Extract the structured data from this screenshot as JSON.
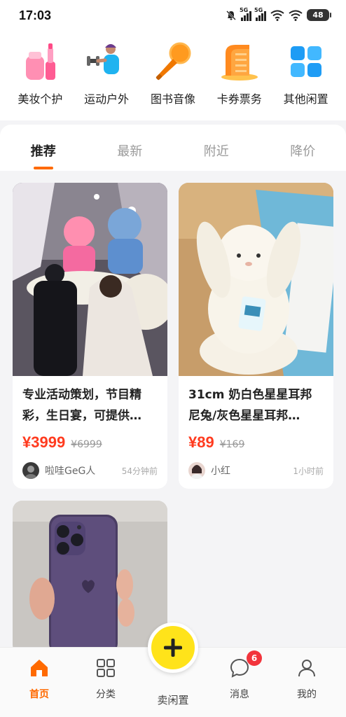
{
  "status_bar": {
    "time": "17:03",
    "network_1": "5G",
    "network_2": "5G",
    "battery": "48"
  },
  "categories": [
    {
      "label": "美妆个护",
      "icon": "cosmetics-icon"
    },
    {
      "label": "运动户外",
      "icon": "fitness-icon"
    },
    {
      "label": "图书音像",
      "icon": "microphone-icon"
    },
    {
      "label": "卡券票务",
      "icon": "ticket-building-icon"
    },
    {
      "label": "其他闲置",
      "icon": "grid-icon"
    }
  ],
  "tabs": [
    {
      "label": "推荐",
      "active": true
    },
    {
      "label": "最新",
      "active": false
    },
    {
      "label": "附近",
      "active": false
    },
    {
      "label": "降价",
      "active": false
    }
  ],
  "feed": [
    {
      "title": "专业活动策划，节目精彩，生日宴，可提供…",
      "price": "¥3999",
      "original_price": "¥6999",
      "seller": "啦哇GeG人",
      "time": "54分钟前",
      "image": "lion-dance-wedding-photo"
    },
    {
      "title": "31cm 奶白色星星耳邦尼兔/灰色星星耳邦…",
      "price": "¥89",
      "original_price": "¥169",
      "seller": "小红",
      "time": "1小时前",
      "image": "plush-bunny-photo"
    },
    {
      "title": "",
      "image": "purple-iphone-photo"
    }
  ],
  "bottom_nav": {
    "home": "首页",
    "category": "分类",
    "sell": "卖闲置",
    "messages": "消息",
    "messages_badge": "6",
    "profile": "我的"
  },
  "colors": {
    "accent": "#ff6a00",
    "price": "#ff3b1f",
    "sell_button": "#ffe31a",
    "badge": "#f2343c"
  }
}
